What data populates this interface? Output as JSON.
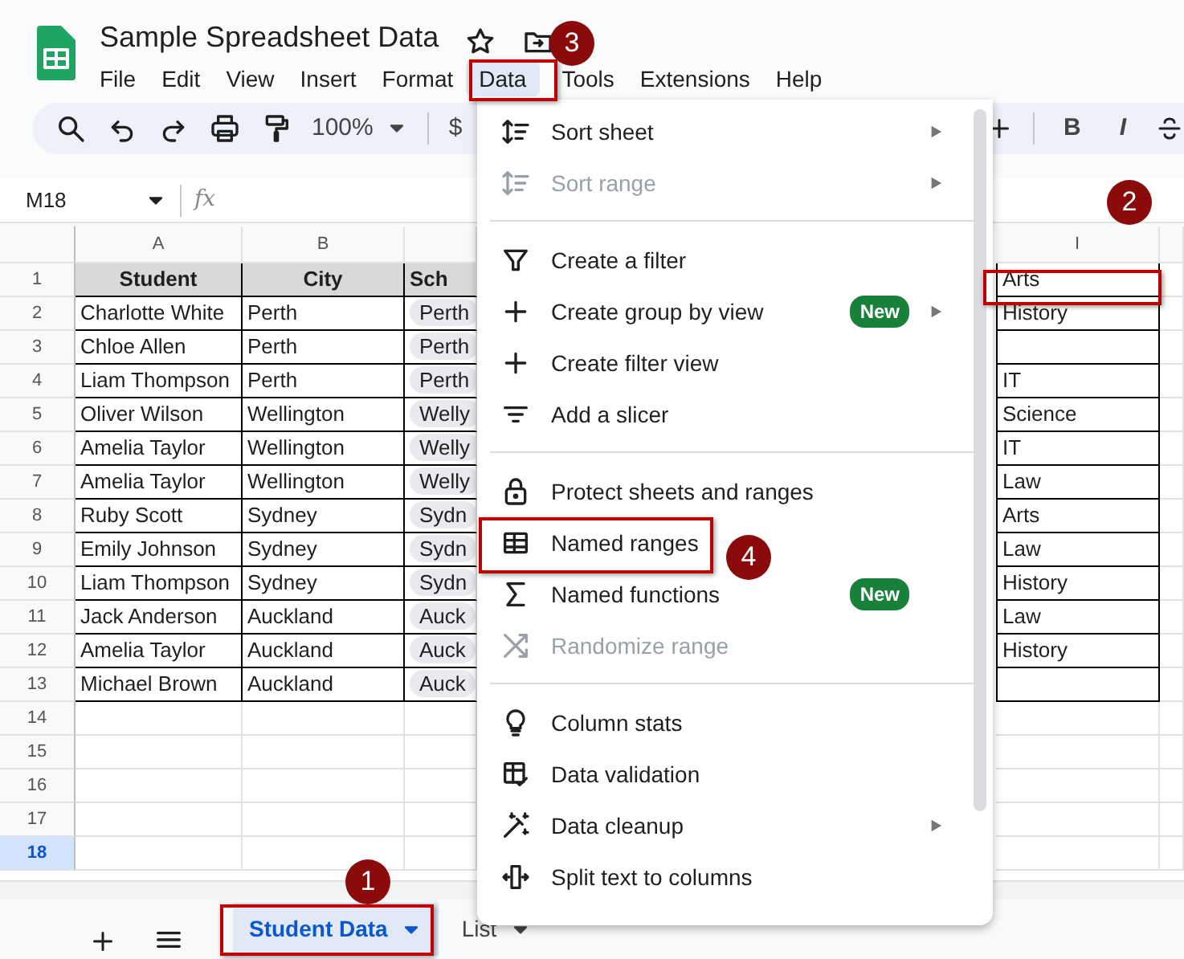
{
  "document": {
    "title": "Sample Spreadsheet Data"
  },
  "menu_bar": [
    {
      "label": "File",
      "selected": false
    },
    {
      "label": "Edit",
      "selected": false
    },
    {
      "label": "View",
      "selected": false
    },
    {
      "label": "Insert",
      "selected": false
    },
    {
      "label": "Format",
      "selected": false
    },
    {
      "label": "Data",
      "selected": true
    },
    {
      "label": "Tools",
      "selected": false
    },
    {
      "label": "Extensions",
      "selected": false
    },
    {
      "label": "Help",
      "selected": false
    }
  ],
  "toolbar": {
    "zoom": "100%",
    "currency": "$",
    "bold": "B",
    "italic": "I"
  },
  "formula_bar": {
    "cell_ref": "M18",
    "fx": "fx"
  },
  "grid": {
    "columns": [
      "A",
      "B",
      "I"
    ],
    "row_numbers": [
      {
        "label": "1",
        "selected": false
      },
      {
        "label": "2",
        "selected": false
      },
      {
        "label": "3",
        "selected": false
      },
      {
        "label": "4",
        "selected": false
      },
      {
        "label": "5",
        "selected": false
      },
      {
        "label": "6",
        "selected": false
      },
      {
        "label": "7",
        "selected": false
      },
      {
        "label": "8",
        "selected": false
      },
      {
        "label": "9",
        "selected": false
      },
      {
        "label": "10",
        "selected": false
      },
      {
        "label": "11",
        "selected": false
      },
      {
        "label": "12",
        "selected": false
      },
      {
        "label": "13",
        "selected": false
      },
      {
        "label": "14",
        "selected": false
      },
      {
        "label": "15",
        "selected": false
      },
      {
        "label": "16",
        "selected": false
      },
      {
        "label": "17",
        "selected": false
      },
      {
        "label": "18",
        "selected": true
      }
    ],
    "rows": [
      {
        "header": true,
        "a": "Student",
        "b": "City",
        "c": "Sch",
        "i": "Arts"
      },
      {
        "header": false,
        "a": "Charlotte White",
        "b": "Perth",
        "c": "Perth",
        "i": "History"
      },
      {
        "header": false,
        "a": "Chloe Allen",
        "b": "Perth",
        "c": "Perth"
      },
      {
        "header": false,
        "a": "Liam Thompson",
        "b": "Perth",
        "c": "Perth",
        "i": "IT"
      },
      {
        "header": false,
        "a": "Oliver Wilson",
        "b": "Wellington",
        "c": "Welly",
        "i": "Science"
      },
      {
        "header": false,
        "a": "Amelia Taylor",
        "b": "Wellington",
        "c": "Welly",
        "i": "IT"
      },
      {
        "header": false,
        "a": "Amelia Taylor",
        "b": "Wellington",
        "c": "Welly",
        "i": "Law"
      },
      {
        "header": false,
        "a": "Ruby Scott",
        "b": "Sydney",
        "c": "Sydn",
        "i": "Arts"
      },
      {
        "header": false,
        "a": "Emily Johnson",
        "b": "Sydney",
        "c": "Sydn",
        "i": "Law"
      },
      {
        "header": false,
        "a": "Liam Thompson",
        "b": "Sydney",
        "c": "Sydn",
        "i": "History"
      },
      {
        "header": false,
        "a": "Jack Anderson",
        "b": "Auckland",
        "c": "Auck",
        "i": "Law"
      },
      {
        "header": false,
        "a": "Amelia Taylor",
        "b": "Auckland",
        "c": "Auck",
        "i": "History"
      },
      {
        "header": false,
        "a": "Michael Brown",
        "b": "Auckland",
        "c": "Auck"
      }
    ]
  },
  "data_menu": {
    "sections": [
      [
        {
          "label": "Sort sheet",
          "disabled": false,
          "submenu": true
        },
        {
          "label": "Sort range",
          "disabled": true,
          "submenu": true
        }
      ],
      [
        {
          "label": "Create a filter",
          "disabled": false,
          "submenu": false
        },
        {
          "label": "Create group by view",
          "disabled": false,
          "submenu": true,
          "badge": "New"
        },
        {
          "label": "Create filter view",
          "disabled": false,
          "submenu": false
        },
        {
          "label": "Add a slicer",
          "disabled": false,
          "submenu": false
        }
      ],
      [
        {
          "label": "Protect sheets and ranges",
          "disabled": false,
          "submenu": false
        },
        {
          "label": "Named ranges",
          "disabled": false,
          "submenu": false
        },
        {
          "label": "Named functions",
          "disabled": false,
          "submenu": false,
          "badge": "New"
        },
        {
          "label": "Randomize range",
          "disabled": true,
          "submenu": false
        }
      ],
      [
        {
          "label": "Column stats",
          "disabled": false,
          "submenu": false
        },
        {
          "label": "Data validation",
          "disabled": false,
          "submenu": false
        },
        {
          "label": "Data cleanup",
          "disabled": false,
          "submenu": true
        },
        {
          "label": "Split text to columns",
          "disabled": false,
          "submenu": false
        }
      ]
    ]
  },
  "sheet_tabs": [
    {
      "label": "Student Data",
      "selected": true
    },
    {
      "label": "List",
      "selected": false
    }
  ],
  "callouts": [
    {
      "number": "1"
    },
    {
      "number": "2"
    },
    {
      "number": "3"
    },
    {
      "number": "4"
    }
  ]
}
